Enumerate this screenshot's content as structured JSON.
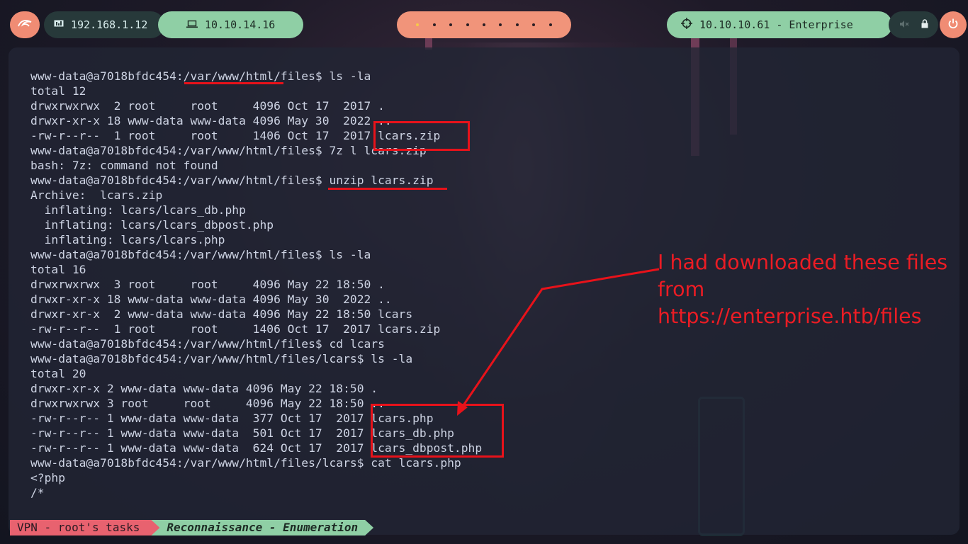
{
  "topbar": {
    "local_ip": "192.168.1.12",
    "vpn_ip": "10.10.14.16",
    "target": "10.10.10.61 - Enterprise",
    "workspaces": [
      "active",
      "",
      "",
      "",
      "",
      "",
      "",
      "",
      ""
    ],
    "icons": [
      "kali-dragon-icon",
      "monitor-icon",
      "laptop-icon",
      "crosshair-icon",
      "volume-muted-icon",
      "lock-icon",
      "power-icon"
    ],
    "colors": {
      "salmon": "#f08c74",
      "green": "#8fcfa5",
      "dark": "#27393a",
      "workspace_active": "#f7c948"
    }
  },
  "terminal": {
    "lines": [
      "www-data@a7018bfdc454:/var/www/html/files$ ls -la",
      "total 12",
      "drwxrwxrwx  2 root     root     4096 Oct 17  2017 .",
      "drwxr-xr-x 18 www-data www-data 4096 May 30  2022 ..",
      "-rw-r--r--  1 root     root     1406 Oct 17  2017 lcars.zip",
      "www-data@a7018bfdc454:/var/www/html/files$ 7z l lcars.zip",
      "bash: 7z: command not found",
      "www-data@a7018bfdc454:/var/www/html/files$ unzip lcars.zip",
      "Archive:  lcars.zip",
      "  inflating: lcars/lcars_db.php",
      "  inflating: lcars/lcars_dbpost.php",
      "  inflating: lcars/lcars.php",
      "www-data@a7018bfdc454:/var/www/html/files$ ls -la",
      "total 16",
      "drwxrwxrwx  3 root     root     4096 May 22 18:50 .",
      "drwxr-xr-x 18 www-data www-data 4096 May 30  2022 ..",
      "drwxr-xr-x  2 www-data www-data 4096 May 22 18:50 lcars",
      "-rw-r--r--  1 root     root     1406 Oct 17  2017 lcars.zip",
      "www-data@a7018bfdc454:/var/www/html/files$ cd lcars",
      "www-data@a7018bfdc454:/var/www/html/files/lcars$ ls -la",
      "total 20",
      "drwxr-xr-x 2 www-data www-data 4096 May 22 18:50 .",
      "drwxrwxrwx 3 root     root     4096 May 22 18:50 ..",
      "-rw-r--r-- 1 www-data www-data  377 Oct 17  2017 lcars.php",
      "-rw-r--r-- 1 www-data www-data  501 Oct 17  2017 lcars_db.php",
      "-rw-r--r-- 1 www-data www-data  624 Oct 17  2017 lcars_dbpost.php",
      "www-data@a7018bfdc454:/var/www/html/files/lcars$ cat lcars.php",
      "<?php",
      "/*"
    ]
  },
  "annotation": {
    "note": "I had downloaded these files from https://enterprise.htb/files",
    "color": "#e8121a"
  },
  "statusbar": {
    "vpn_label": "VPN - root's tasks",
    "task_label": "Reconnaissance - Enumeration",
    "colors": {
      "vpn": "#e8626f",
      "task": "#8fcfa5"
    }
  }
}
